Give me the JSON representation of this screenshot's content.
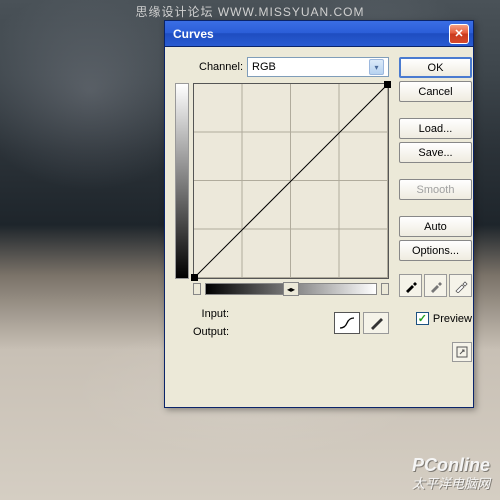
{
  "watermark_top": "思缘设计论坛  WWW.MISSYUAN.COM",
  "watermark_bottom": {
    "brand": "PConline",
    "sub": "太平洋电脑网"
  },
  "dialog": {
    "title": "Curves",
    "channel_label": "Channel:",
    "channel_value": "RGB",
    "input_label": "Input:",
    "output_label": "Output:",
    "buttons": {
      "ok": "OK",
      "cancel": "Cancel",
      "load": "Load...",
      "save": "Save...",
      "smooth": "Smooth",
      "auto": "Auto",
      "options": "Options..."
    },
    "preview_label": "Preview",
    "preview_checked": true
  }
}
